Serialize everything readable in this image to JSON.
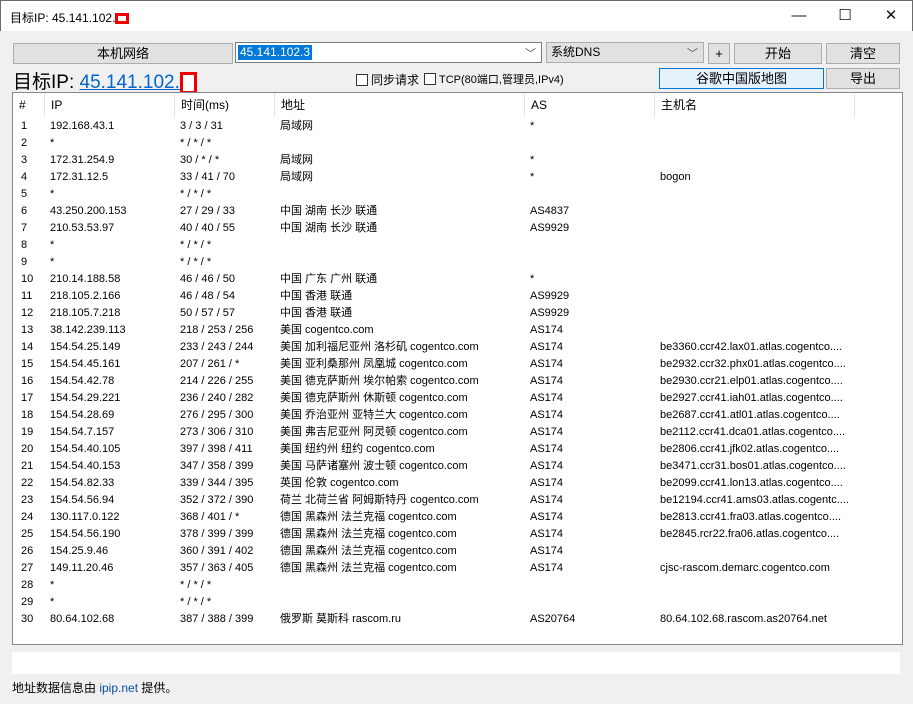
{
  "window": {
    "title": "目标IP: 45.141.102.",
    "minimize": "—",
    "maximize": "☐",
    "close": "✕"
  },
  "toolbar": {
    "local_network": "本机网络",
    "target_input": "45.141.102.3",
    "dns_select": "系统DNS",
    "plus": "+",
    "start": "开始",
    "clear": "清空",
    "sync_request": "同步请求",
    "tcp": "TCP(80端口,管理员,IPv4)",
    "google_map": "谷歌中国版地图",
    "export": "导出"
  },
  "target": {
    "label": "目标IP: ",
    "ip": "45.141.102."
  },
  "columns": [
    "#",
    "IP",
    "时间(ms)",
    "地址",
    "AS",
    "主机名"
  ],
  "rows": [
    [
      "1",
      "192.168.43.1",
      "3 / 3 / 31",
      "局域网",
      "*",
      ""
    ],
    [
      "2",
      "*",
      "* / * / *",
      "",
      "",
      ""
    ],
    [
      "3",
      "172.31.254.9",
      "30 / * / *",
      "局域网",
      "*",
      ""
    ],
    [
      "4",
      "172.31.12.5",
      "33 / 41 / 70",
      "局域网",
      "*",
      "bogon"
    ],
    [
      "5",
      "*",
      "* / * / *",
      "",
      "",
      ""
    ],
    [
      "6",
      "43.250.200.153",
      "27 / 29 / 33",
      "中国 湖南 长沙 联通",
      "AS4837",
      ""
    ],
    [
      "7",
      "210.53.53.97",
      "40 / 40 / 55",
      "中国 湖南 长沙 联通",
      "AS9929",
      ""
    ],
    [
      "8",
      "*",
      "* / * / *",
      "",
      "",
      ""
    ],
    [
      "9",
      "*",
      "* / * / *",
      "",
      "",
      ""
    ],
    [
      "10",
      "210.14.188.58",
      "46 / 46 / 50",
      "中国 广东 广州 联通",
      "*",
      ""
    ],
    [
      "11",
      "218.105.2.166",
      "46 / 48 / 54",
      "中国 香港 联通",
      "AS9929",
      ""
    ],
    [
      "12",
      "218.105.7.218",
      "50 / 57 / 57",
      "中国 香港 联通",
      "AS9929",
      ""
    ],
    [
      "13",
      "38.142.239.113",
      "218 / 253 / 256",
      "美国 cogentco.com",
      "AS174",
      ""
    ],
    [
      "14",
      "154.54.25.149",
      "233 / 243 / 244",
      "美国 加利福尼亚州 洛杉矶 cogentco.com",
      "AS174",
      "be3360.ccr42.lax01.atlas.cogentco...."
    ],
    [
      "15",
      "154.54.45.161",
      "207 / 261 / *",
      "美国 亚利桑那州 凤凰城 cogentco.com",
      "AS174",
      "be2932.ccr32.phx01.atlas.cogentco...."
    ],
    [
      "16",
      "154.54.42.78",
      "214 / 226 / 255",
      "美国 德克萨斯州 埃尔帕索 cogentco.com",
      "AS174",
      "be2930.ccr21.elp01.atlas.cogentco...."
    ],
    [
      "17",
      "154.54.29.221",
      "236 / 240 / 282",
      "美国 德克萨斯州 休斯顿 cogentco.com",
      "AS174",
      "be2927.ccr41.iah01.atlas.cogentco...."
    ],
    [
      "18",
      "154.54.28.69",
      "276 / 295 / 300",
      "美国 乔治亚州 亚特兰大 cogentco.com",
      "AS174",
      "be2687.ccr41.atl01.atlas.cogentco...."
    ],
    [
      "19",
      "154.54.7.157",
      "273 / 306 / 310",
      "美国 弗吉尼亚州 阿灵顿 cogentco.com",
      "AS174",
      "be2112.ccr41.dca01.atlas.cogentco...."
    ],
    [
      "20",
      "154.54.40.105",
      "397 / 398 / 411",
      "美国 纽约州 纽约 cogentco.com",
      "AS174",
      "be2806.ccr41.jfk02.atlas.cogentco...."
    ],
    [
      "21",
      "154.54.40.153",
      "347 / 358 / 399",
      "美国 马萨诸塞州 波士顿 cogentco.com",
      "AS174",
      "be3471.ccr31.bos01.atlas.cogentco...."
    ],
    [
      "22",
      "154.54.82.33",
      "339 / 344 / 395",
      "英国 伦敦 cogentco.com",
      "AS174",
      "be2099.ccr41.lon13.atlas.cogentco...."
    ],
    [
      "23",
      "154.54.56.94",
      "352 / 372 / 390",
      "荷兰 北荷兰省 阿姆斯特丹 cogentco.com",
      "AS174",
      "be12194.ccr41.ams03.atlas.cogentc...."
    ],
    [
      "24",
      "130.117.0.122",
      "368 / 401 / *",
      "德国 黑森州 法兰克福 cogentco.com",
      "AS174",
      "be2813.ccr41.fra03.atlas.cogentco...."
    ],
    [
      "25",
      "154.54.56.190",
      "378 / 399 / 399",
      "德国 黑森州 法兰克福 cogentco.com",
      "AS174",
      "be2845.rcr22.fra06.atlas.cogentco...."
    ],
    [
      "26",
      "154.25.9.46",
      "360 / 391 / 402",
      "德国 黑森州 法兰克福 cogentco.com",
      "AS174",
      ""
    ],
    [
      "27",
      "149.11.20.46",
      "357 / 363 / 405",
      "德国 黑森州 法兰克福 cogentco.com",
      "AS174",
      "cjsc-rascom.demarc.cogentco.com"
    ],
    [
      "28",
      "*",
      "* / * / *",
      "",
      "",
      ""
    ],
    [
      "29",
      "*",
      "* / * / *",
      "",
      "",
      ""
    ],
    [
      "30",
      "80.64.102.68",
      "387 / 388 / 399",
      "俄罗斯 莫斯科 rascom.ru",
      "AS20764",
      "80.64.102.68.rascom.as20764.net"
    ]
  ],
  "status": {
    "prefix": "地址数据信息由 ",
    "link": "ipip.net",
    "suffix": " 提供。"
  }
}
